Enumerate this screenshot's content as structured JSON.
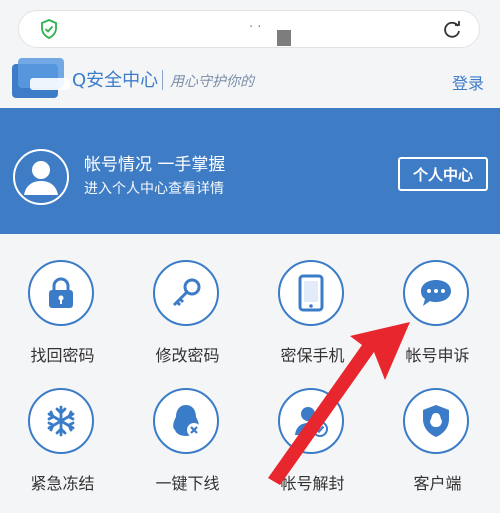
{
  "browser": {
    "url_text": "·  ·",
    "shield_icon": "shield-check-icon",
    "refresh_icon": "refresh-icon"
  },
  "header": {
    "brand": "Q安全中心",
    "slogan": "用心守护你的",
    "login": "登录"
  },
  "banner": {
    "title": "帐号情况 一手掌握",
    "subtitle": "进入个人中心查看详情",
    "center_button": "个人中心"
  },
  "grid": {
    "items": [
      {
        "label": "找回密码",
        "icon": "lock-icon"
      },
      {
        "label": "修改密码",
        "icon": "key-icon"
      },
      {
        "label": "密保手机",
        "icon": "phone-icon"
      },
      {
        "label": "帐号申诉",
        "icon": "chat-bubble-icon"
      },
      {
        "label": "紧急冻结",
        "icon": "snowflake-icon"
      },
      {
        "label": "一键下线",
        "icon": "penguin-offline-icon"
      },
      {
        "label": "帐号解封",
        "icon": "user-check-icon"
      },
      {
        "label": "客户端",
        "icon": "penguin-shield-icon"
      }
    ]
  },
  "colors": {
    "accent": "#3e7cc5",
    "arrow": "#e8262d"
  }
}
